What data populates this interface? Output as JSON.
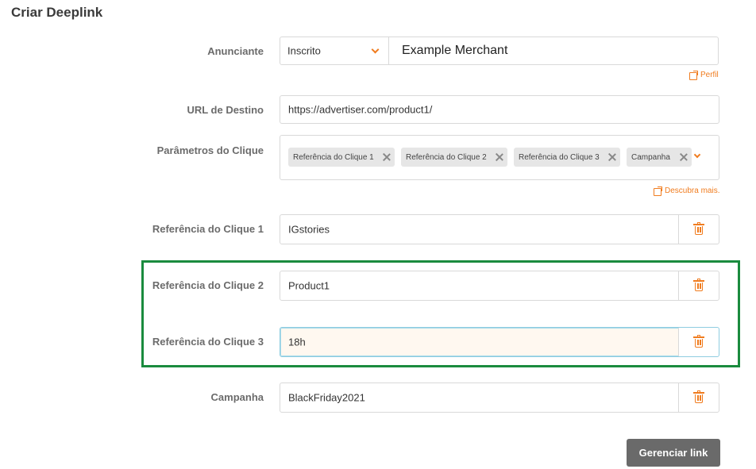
{
  "page_title": "Criar Deeplink",
  "advertiser": {
    "label": "Anunciante",
    "select_value": "Inscrito",
    "merchant_name": "Example Merchant",
    "profile_link": "Perfil"
  },
  "destination": {
    "label": "URL de Destino",
    "value": "https://advertiser.com/product1/"
  },
  "params": {
    "label": "Parâmetros do Clique",
    "chips": [
      "Referência do Clique 1",
      "Referência do Clique 2",
      "Referência do Clique 3",
      "Campanha"
    ],
    "learn_more": "Descubra mais."
  },
  "fields": [
    {
      "label": "Referência do Clique 1",
      "value": "IGstories"
    },
    {
      "label": "Referência do Clique 2",
      "value": "Product1"
    },
    {
      "label": "Referência do Clique 3",
      "value": "18h"
    },
    {
      "label": "Campanha",
      "value": "BlackFriday2021"
    }
  ],
  "submit_label": "Gerenciar link",
  "colors": {
    "accent": "#f07c1f",
    "highlight": "#1a8b3e",
    "button": "#6a6a6a"
  }
}
